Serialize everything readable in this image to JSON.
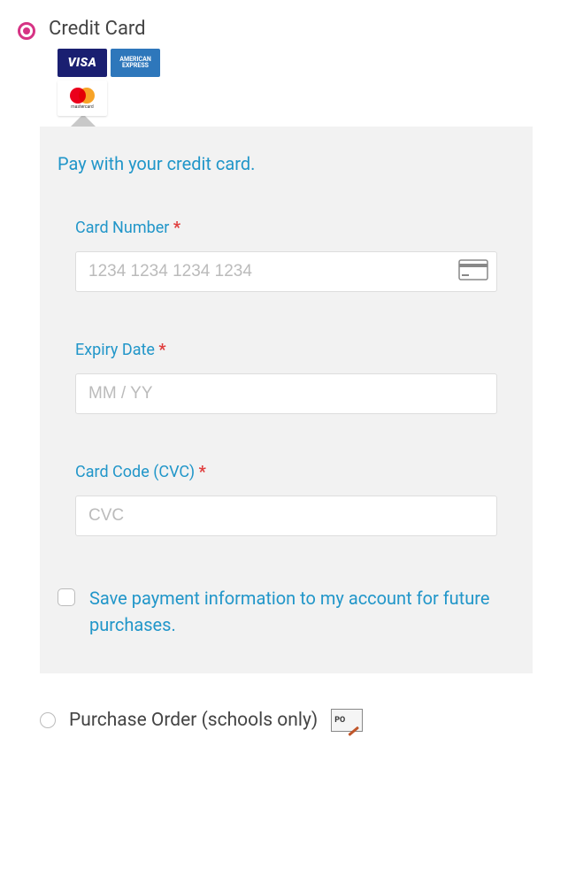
{
  "paymentOptions": {
    "creditCard": {
      "label": "Credit Card",
      "logos": {
        "visa": "VISA",
        "amex_line1": "AMERICAN",
        "amex_line2": "EXPRESS",
        "mastercard": "mastercard"
      }
    },
    "purchaseOrder": {
      "label": "Purchase Order (schools only)",
      "icon_text": "PO"
    }
  },
  "panel": {
    "subtitle": "Pay with your credit card."
  },
  "fields": {
    "cardNumber": {
      "label": "Card Number",
      "placeholder": "1234 1234 1234 1234"
    },
    "expiry": {
      "label": "Expiry Date",
      "placeholder": "MM / YY"
    },
    "cvc": {
      "label": "Card Code (CVC)",
      "placeholder": "CVC"
    }
  },
  "saveInfo": {
    "label": "Save payment information to my account for future purchases."
  },
  "requiredMark": "*"
}
